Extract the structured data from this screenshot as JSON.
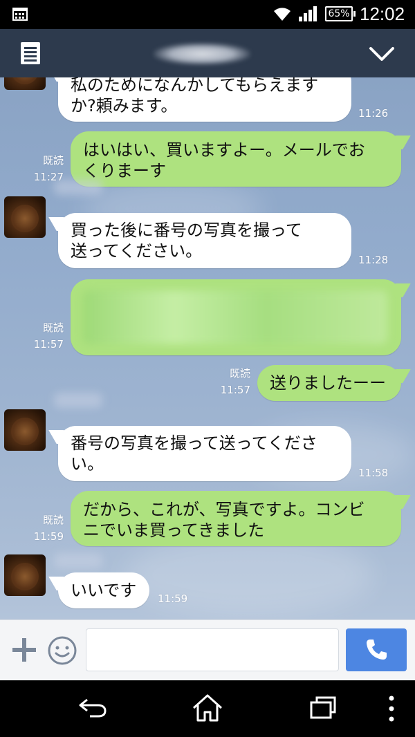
{
  "status_bar": {
    "time": "12:02",
    "battery": "65%",
    "icons": [
      "calendar-icon",
      "wifi-icon",
      "signal-icon",
      "battery-icon"
    ]
  },
  "header": {
    "menu_icon": "menu-icon",
    "collapse_icon": "chevron-down-icon"
  },
  "messages": [
    {
      "side": "in",
      "text": "私のためになんかしてもらえます\nか?頼みます。",
      "time": "11:26",
      "read": ""
    },
    {
      "side": "out",
      "text": "はいはい、買いますよー。メールでお\nくりまーす",
      "time": "11:27",
      "read": "既読"
    },
    {
      "side": "in",
      "text": "買った後に番号の写真を撮って\n送ってください。",
      "time": "11:28",
      "read": ""
    },
    {
      "side": "out",
      "text": "",
      "time": "11:57",
      "read": "既読"
    },
    {
      "side": "out",
      "text": "送りましたーー",
      "time": "11:57",
      "read": "既読"
    },
    {
      "side": "in",
      "text": "番号の写真を撮って送ってくださ\nい。",
      "time": "11:58",
      "read": ""
    },
    {
      "side": "out",
      "text": "だから、これが、写真ですよ。コンビ\nニでいま買ってきました",
      "time": "11:59",
      "read": "既読"
    },
    {
      "side": "in",
      "text": "いいです",
      "time": "11:59",
      "read": ""
    }
  ],
  "input": {
    "placeholder": "",
    "value": ""
  },
  "colors": {
    "header_bg": "#2d3a4d",
    "outgoing_bubble": "#aee27f",
    "incoming_bubble": "#ffffff",
    "call_button": "#4d86e2"
  }
}
